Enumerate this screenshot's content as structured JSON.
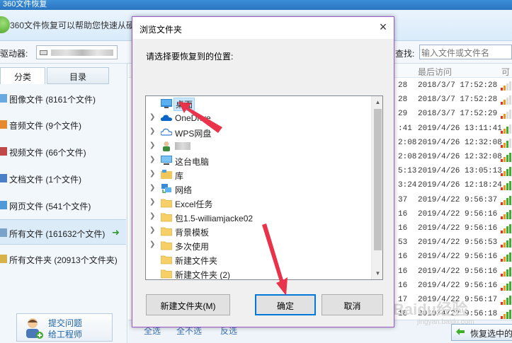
{
  "app": {
    "title": "360文件恢复",
    "banner_text": "360文件恢复可以帮助您快速从硬",
    "drive_label": "驱动器:",
    "search_label": "查找:",
    "search_placeholder": "输入文件或文件名"
  },
  "sidebar": {
    "tabs": [
      "分类",
      "目录"
    ],
    "items": [
      {
        "label": "图像文件 (8161个文件)",
        "icon": "image-file-icon"
      },
      {
        "label": "音频文件 (9个文件)",
        "icon": "audio-file-icon"
      },
      {
        "label": "视频文件 (66个文件)",
        "icon": "video-file-icon"
      },
      {
        "label": "文档文件 (1个文件)",
        "icon": "document-file-icon"
      },
      {
        "label": "网页文件 (541个文件)",
        "icon": "web-file-icon"
      },
      {
        "label": "所有文件 (161632个文件)",
        "icon": "all-files-icon"
      },
      {
        "label": "所有文件夹 (20913个文件夹)",
        "icon": "all-folders-icon"
      }
    ],
    "help": {
      "line1": "提交问题",
      "line2": "给工程师"
    }
  },
  "list": {
    "header_last_access": "最后访问",
    "header_recoverable": "可",
    "rows": [
      {
        "part": "28",
        "datetime": "2018/3/7 17:52:28",
        "level": 0.4
      },
      {
        "part": "28",
        "datetime": "2018/3/7 17:52:28",
        "level": 0.5
      },
      {
        "part": "29",
        "datetime": "2018/3/7 17:52:29",
        "level": 0.5
      },
      {
        "part": ":41",
        "datetime": "2019/4/26 13:11:41",
        "level": 0.7
      },
      {
        "part": "2:08",
        "datetime": "2019/4/26 12:32:08",
        "level": 0.8
      },
      {
        "part": "2:08",
        "datetime": "2019/4/26 12:32:08",
        "level": 0.9
      },
      {
        "part": "5:13",
        "datetime": "2019/4/26 13:05:13",
        "level": 1.0
      },
      {
        "part": "3:24",
        "datetime": "2019/4/26 12:18:24",
        "level": 1.0
      },
      {
        "part": "37",
        "datetime": "2019/4/22 9:56:37",
        "level": 1.0
      },
      {
        "part": "16",
        "datetime": "2019/4/22 9:56:16",
        "level": 1.0
      },
      {
        "part": "16",
        "datetime": "2019/4/22 9:56:16",
        "level": 1.0
      },
      {
        "part": "53",
        "datetime": "2019/4/22 9:56:53",
        "level": 1.0
      },
      {
        "part": "16",
        "datetime": "2019/4/22 9:56:16",
        "level": 1.0
      },
      {
        "part": "16",
        "datetime": "2019/4/22 9:56:16",
        "level": 1.0
      },
      {
        "part": "16",
        "datetime": "2019/4/22 9:56:16",
        "level": 1.0
      },
      {
        "part": "17",
        "datetime": "2019/4/22 9:56:17",
        "level": 1.0
      },
      {
        "part": "18",
        "datetime": "2019/4/22 9:56:18",
        "level": 1.0
      }
    ],
    "bar_colors": {
      "red": "#e0321e",
      "orange": "#f2951c",
      "green": "#3fae2a"
    }
  },
  "bottom": {
    "select_all": "全选",
    "select_none": "全不选",
    "invert": "反选",
    "recover_button": "恢复选中的"
  },
  "watermark": {
    "main": "Baidu经验",
    "sub": "jingyan.baidu.com"
  },
  "dialog": {
    "title": "浏览文件夹",
    "close": "×",
    "prompt": "请选择要恢复到的位置:",
    "tree": [
      {
        "label": "桌面",
        "icon": "desktop-icon",
        "expandable": false,
        "selected": true
      },
      {
        "label": "OneDrive",
        "icon": "onedrive-cloud-icon",
        "expandable": true
      },
      {
        "label": "WPS网盘",
        "icon": "wps-cloud-icon",
        "expandable": true
      },
      {
        "label": "",
        "icon": "user-icon",
        "expandable": true
      },
      {
        "label": "这台电脑",
        "icon": "this-pc-icon",
        "expandable": true
      },
      {
        "label": "库",
        "icon": "library-icon",
        "expandable": true
      },
      {
        "label": "网络",
        "icon": "network-icon",
        "expandable": true
      },
      {
        "label": "Excel任务",
        "icon": "folder-icon",
        "expandable": true
      },
      {
        "label": "包1.5-williamjacke02",
        "icon": "folder-icon",
        "expandable": true
      },
      {
        "label": "背景模板",
        "icon": "folder-icon",
        "expandable": true
      },
      {
        "label": "多次使用",
        "icon": "folder-icon",
        "expandable": true
      },
      {
        "label": "新建文件夹",
        "icon": "folder-icon",
        "expandable": false
      },
      {
        "label": "新建文件夹 (2)",
        "icon": "folder-icon",
        "expandable": false
      }
    ],
    "buttons": {
      "new_folder": "新建文件夹(M)",
      "ok": "确定",
      "cancel": "取消"
    },
    "accent_color": "#0078d7",
    "annotation_color": "#e8334a"
  }
}
